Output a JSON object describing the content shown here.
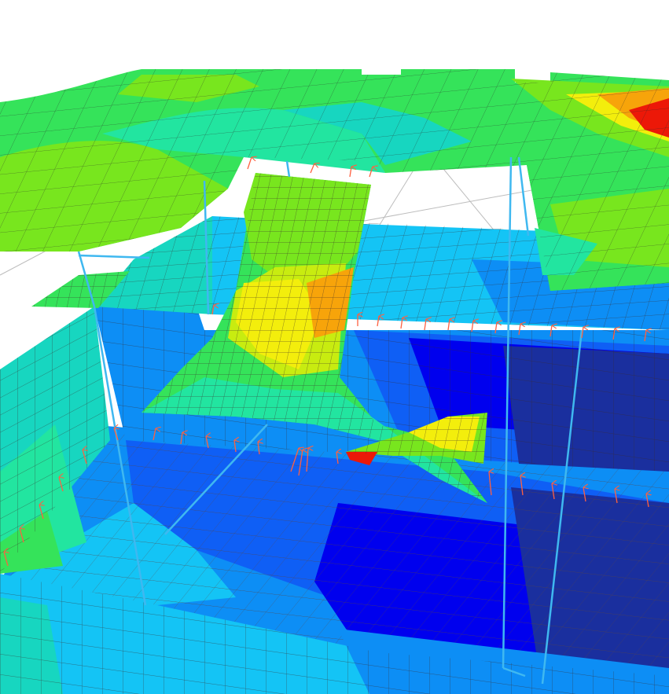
{
  "viewport": {
    "background": "#ffffff",
    "content": "fem-mesh-contour-3d"
  },
  "palette": {
    "deep_blue": "#0000ee",
    "navy": "#1a2f9e",
    "blue": "#0f5ff5",
    "mid_blue": "#0d8ef5",
    "light_blue": "#14c4f5",
    "cyan_teal": "#17d6c0",
    "green_teal": "#22e5a0",
    "green": "#35e35a",
    "lime": "#78e61e",
    "yellow_green": "#c8ec10",
    "yellow": "#f3ee0c",
    "orange": "#f7a40a",
    "red": "#ec1808",
    "mesh_line": "#3a2a2a",
    "load_arrow": "#ff6040",
    "frame_line": "#3fb8f0"
  },
  "icons": {
    "load_arrows": "red-arrow-icon"
  }
}
